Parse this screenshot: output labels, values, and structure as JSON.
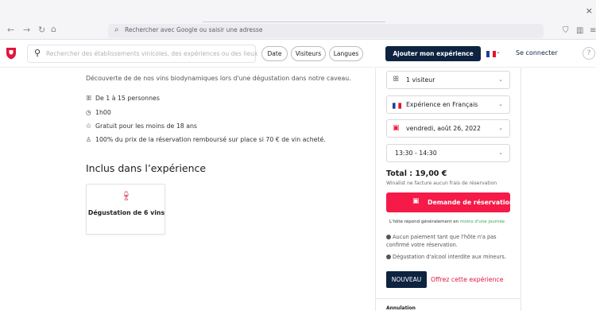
{
  "browser": {
    "close_glyph": "×",
    "nav_icons": [
      "arrow-left-icon",
      "arrow-right-icon",
      "reload-icon",
      "home-icon"
    ],
    "url_placeholder": "Rechercher avec Google ou saisir une adresse"
  },
  "header": {
    "search_placeholder": "Rechercher des établissements vinicoles, des expériences ou des lieux",
    "pills": [
      "Date",
      "Visiteurs",
      "Langues"
    ],
    "cta_label": "Ajouter mon expérience",
    "login_label": "Se connecter",
    "help_glyph": "?",
    "brand_color": "#e0163e",
    "navy_color": "#0d2340"
  },
  "content": {
    "description": "Découverte de de nos vins biodynamiques lors d'une dégustation dans notre caveau.",
    "features": [
      {
        "icon": "people-icon",
        "text": "De 1 à 15 personnes"
      },
      {
        "icon": "clock-icon",
        "text": "1h00"
      },
      {
        "icon": "child-icon",
        "text": "Gratuit pour les moins de 18 ans"
      },
      {
        "icon": "bottle-icon",
        "text": "100% du prix de la réservation remboursé sur place si 70 € de vin acheté."
      }
    ],
    "included_heading": "Inclus dans l’expérience",
    "included_items": [
      {
        "icon": "wine-glass-icon",
        "label": "Dégustation de 6 vins"
      }
    ]
  },
  "booking": {
    "visitors": "1 visiteur",
    "language": "Expérience en Français",
    "date": "vendredi, août 26, 2022",
    "time": "13:30 - 14:30",
    "total": "Total : 19,00 €",
    "fees_note": "Winalist ne facture aucun frais de réservation",
    "reserve_label": "Demande de réservation",
    "reply_prefix": "L'hôte répond généralement en",
    "reply_highlight": "moins d'une journée",
    "notes": [
      "Aucun paiement tant que l'hôte n'a pas confirmé votre réservation.",
      "Dégustation d'alcool interdite aux mineurs."
    ],
    "new_badge": "NOUVEAU",
    "offer_label": "Offrez cette expérience",
    "cancel_heading": "Annulation",
    "accent_color": "#f51a48"
  }
}
